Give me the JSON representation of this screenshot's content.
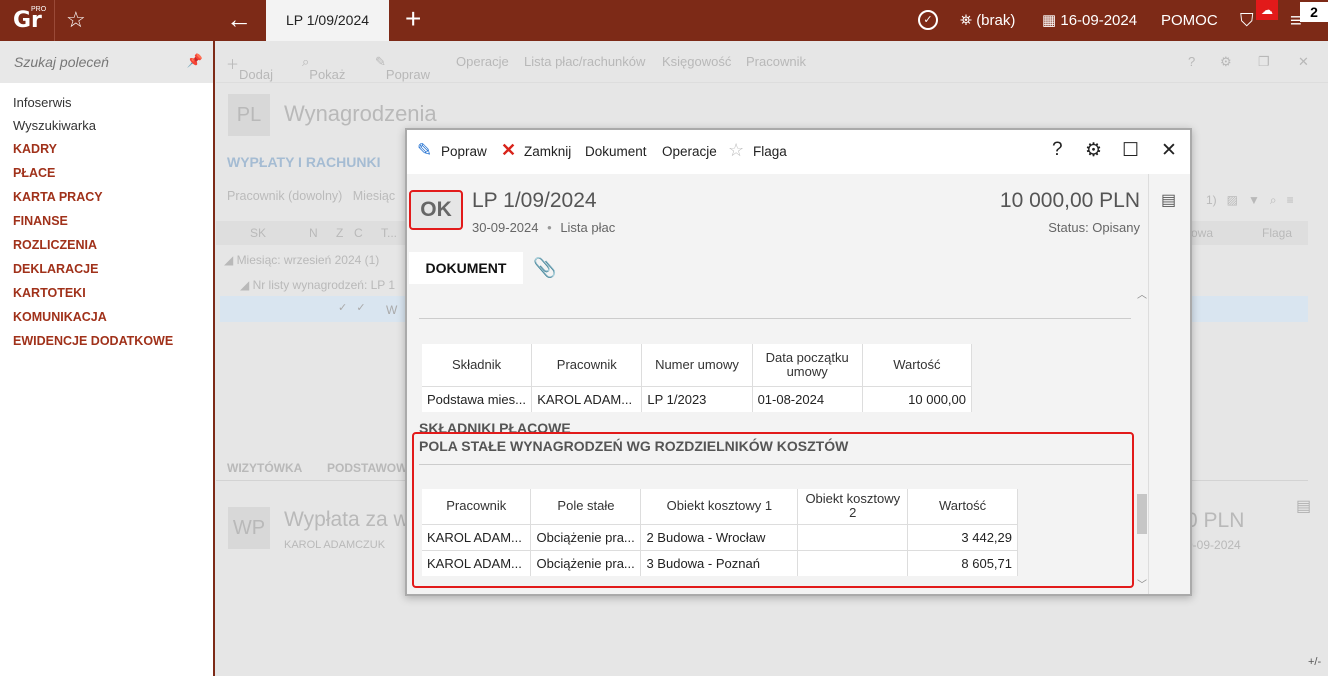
{
  "topbar": {
    "logo": "Gr",
    "logo_sup": "PRO",
    "active_tab": "LP 1/09/2024",
    "user": "(brak)",
    "date": "16-09-2024",
    "help": "POMOC",
    "badge_count": "2",
    "colors": {
      "bar": "#7d2a17",
      "alert": "#e21a1a"
    }
  },
  "sidebar": {
    "search_placeholder": "Szukaj poleceń",
    "plain_items": [
      "Infoserwis",
      "Wyszukiwarka"
    ],
    "sections": [
      "KADRY",
      "PŁACE",
      "KARTA PRACY",
      "FINANSE",
      "ROZLICZENIA",
      "DEKLARACJE",
      "KARTOTEKI",
      "KOMUNIKACJA",
      "EWIDENCJE DODATKOWE"
    ]
  },
  "main": {
    "toolbar": [
      "Dodaj",
      "Pokaż",
      "Popraw",
      "Operacje",
      "Lista płac/rachunków",
      "Księgowość",
      "Pracownik"
    ],
    "icon_box": "PL",
    "title": "Wynagrodzenia",
    "section": "WYPŁATY I RACHUNKI",
    "filter_employee": "Pracownik (dowolny)",
    "filter_month": "Miesiąc",
    "grid_cols": [
      "SK",
      "N",
      "Z",
      "C",
      "T..."
    ],
    "right_cols": [
      "owa",
      "Flaga"
    ],
    "tree_month": "Miesiąc: wrzesień 2024 (1)",
    "tree_list": "Nr listy wynagrodzeń: LP 1",
    "row_text": "W",
    "bottom_tabs": [
      "WIZYTÓWKA",
      "PODSTAWOW"
    ],
    "wp_box": "WP",
    "wp_title": "Wypłata za w",
    "wp_sub": "KAROL ADAMCZUK",
    "right_amount": "0 PLN",
    "right_date": "0-09-2024",
    "plusminus": "+/-"
  },
  "modal": {
    "toolbar": {
      "edit": "Popraw",
      "close": "Zamknij",
      "document": "Dokument",
      "operations": "Operacje",
      "flag": "Flaga"
    },
    "status_box": "OK",
    "doc_title": "LP 1/09/2024",
    "doc_date": "30-09-2024",
    "doc_separator": "•",
    "doc_type": "Lista płac",
    "amount": "10 000,00 PLN",
    "status": "Status: Opisany",
    "tab": "DOKUMENT",
    "section1": {
      "title": "SKŁADNIKI PŁACOWE",
      "headers": [
        "Składnik",
        "Pracownik",
        "Numer umowy",
        "Data początku umowy",
        "Wartość"
      ],
      "rows": [
        [
          "Podstawa mies...",
          "KAROL ADAM...",
          "LP 1/2023",
          "01-08-2024",
          "10 000,00"
        ]
      ]
    },
    "section2": {
      "title": "POLA STAŁE WYNAGRODZEŃ WG ROZDZIELNIKÓW KOSZTÓW",
      "headers": [
        "Pracownik",
        "Pole stałe",
        "Obiekt kosztowy 1",
        "Obiekt kosztowy 2",
        "Wartość"
      ],
      "rows": [
        [
          "KAROL ADAM...",
          "Obciążenie pra...",
          "2 Budowa - Wrocław",
          "",
          "3 442,29"
        ],
        [
          "KAROL ADAM...",
          "Obciążenie pra...",
          "3 Budowa - Poznań",
          "",
          "8 605,71"
        ]
      ]
    }
  }
}
